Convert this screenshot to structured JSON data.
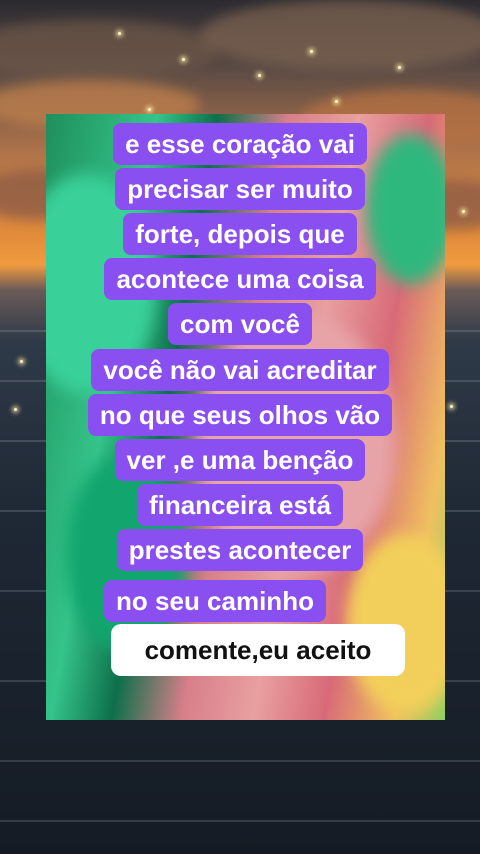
{
  "caption_lines": [
    "e esse  coração vai",
    "precisar ser muito",
    "forte, depois que",
    "acontece uma coisa",
    "com você",
    "você não vai acreditar",
    "no que seus olhos vão",
    "ver ,e uma benção",
    "financeira está",
    "prestes acontecer",
    "no seu caminho"
  ],
  "cta_text": "comente,eu aceito",
  "colors": {
    "caption_bg": "#8a4ff0",
    "caption_text": "#ffffff",
    "cta_bg": "#ffffff",
    "cta_text": "#111111"
  }
}
